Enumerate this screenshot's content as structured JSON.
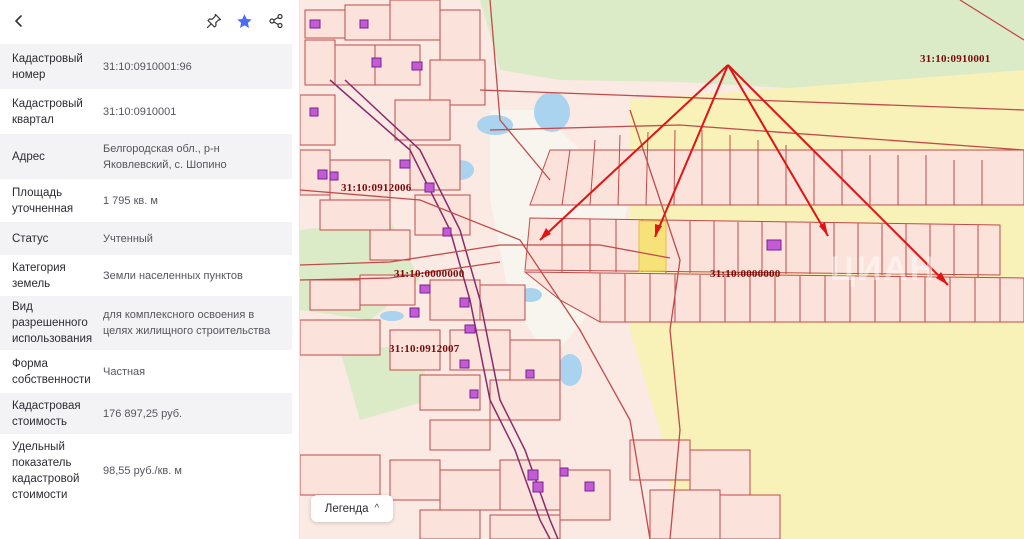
{
  "header": {
    "back_icon": "chevron-left-icon",
    "pin_icon": "pin-icon",
    "star_icon": "star-icon",
    "share_icon": "share-icon",
    "star_color": "#4a6cf7"
  },
  "details": [
    {
      "label": "Кадастровый номер",
      "value": "31:10:0910001:96"
    },
    {
      "label": "Кадастровый квартал",
      "value": "31:10:0910001"
    },
    {
      "label": "Адрес",
      "value": "Белгородская обл., р-н Яковлевский, с. Шопино"
    },
    {
      "label": "Площадь уточненная",
      "value": "1 795 кв. м"
    },
    {
      "label": "Статус",
      "value": "Учтенный"
    },
    {
      "label": "Категория земель",
      "value": "Земли населенных пунктов"
    },
    {
      "label": "Вид разрешенного использования",
      "value": "для комплексного освоения в целях жилищного строительства"
    },
    {
      "label": "Форма собственности",
      "value": "Частная"
    },
    {
      "label": "Кадастровая стоимость",
      "value": "176 897,25 руб."
    },
    {
      "label": "Удельный показатель кадастровой стоимости",
      "value": "98,55 руб./кв. м"
    }
  ],
  "map": {
    "labels": {
      "quarter_top_right": "31:10:0910001",
      "quarter_left_mid": "31:10:0912006",
      "quarter_center_left": "31:10:0000000",
      "quarter_center": "31:10:0000000",
      "quarter_left_low": "31:10:0912007"
    },
    "legend_button": "Легенда",
    "legend_caret": "^",
    "parcel_color": "#fbe3dc",
    "boundary_color": "#c24a4a",
    "arrow_color": "#e01414",
    "highlight_color": "#f7e27a",
    "field_color": "#f8f1b8",
    "forest_color": "#dcebc7"
  }
}
